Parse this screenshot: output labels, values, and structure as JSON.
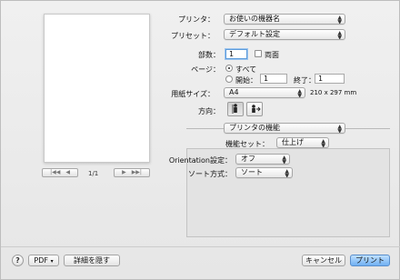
{
  "preview": {
    "page_indicator": "1/1"
  },
  "printer": {
    "label": "プリンタ：",
    "value": "お使いの機器名"
  },
  "preset": {
    "label": "プリセット：",
    "value": "デフォルト設定"
  },
  "copies": {
    "label": "部数：",
    "value": "1",
    "duplex_label": "両面"
  },
  "pages": {
    "label": "ページ：",
    "all_label": "すべて",
    "from_label": "開始：",
    "from_value": "1",
    "to_label": "終了：",
    "to_value": "1"
  },
  "paper": {
    "label": "用紙サイズ：",
    "value": "A4",
    "dimensions": "210 x 297 mm"
  },
  "orientation": {
    "label": "方向："
  },
  "section": {
    "value": "プリンタの機能"
  },
  "feature_set": {
    "label": "機能セット：",
    "value": "仕上げ"
  },
  "orientation_setting": {
    "label": "Orientation設定：",
    "value": "オフ"
  },
  "sort_method": {
    "label": "ソート方式：",
    "value": "ソート"
  },
  "footer": {
    "help": "?",
    "pdf": "PDF",
    "hide_details": "詳細を隠す",
    "cancel": "キャンセル",
    "print": "プリント"
  }
}
